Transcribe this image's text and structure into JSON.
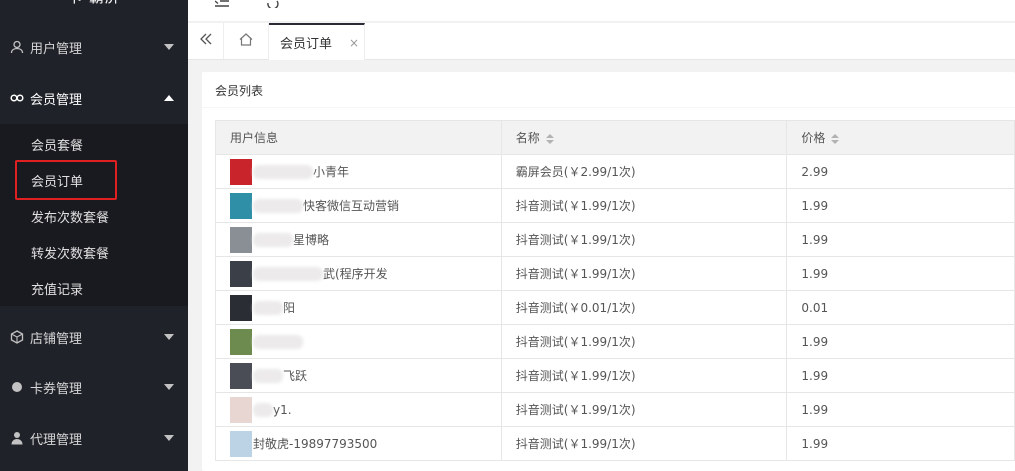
{
  "sidebar": {
    "logo": "卡 \t霸屏",
    "groups": [
      {
        "label": "用户管理",
        "icon": "user-icon"
      },
      {
        "label": "会员管理",
        "icon": "link-icon"
      },
      {
        "label": "店铺管理",
        "icon": "box-icon"
      },
      {
        "label": "卡券管理",
        "icon": "circle-icon"
      },
      {
        "label": "代理管理",
        "icon": "person-icon"
      }
    ],
    "member_items": [
      "会员套餐",
      "会员订单",
      "发布次数套餐",
      "转发次数套餐",
      "充值记录"
    ]
  },
  "header": {
    "menu_icon": "menu-fold-icon",
    "refresh_icon": "refresh-icon"
  },
  "tabs": {
    "active_label": "会员订单",
    "close_glyph": "×"
  },
  "card": {
    "title": "会员列表"
  },
  "table": {
    "headers": [
      "用户信息",
      "名称",
      "价格"
    ],
    "rows": [
      {
        "user": "小青年",
        "name": "霸屏会员(￥2.99/1次)",
        "price": "2.99",
        "avatar_color": "#c9242c"
      },
      {
        "user": "快客微信互动营销",
        "name": "抖音测试(￥1.99/1次)",
        "price": "1.99",
        "avatar_color": "#2f8fa6"
      },
      {
        "user": "星博略",
        "name": "抖音测试(￥1.99/1次)",
        "price": "1.99",
        "avatar_color": "#8a8f96"
      },
      {
        "user": "武(程序开发",
        "name": "抖音测试(￥1.99/1次)",
        "price": "1.99",
        "avatar_color": "#3b3f47"
      },
      {
        "user": "阳",
        "name": "抖音测试(￥0.01/1次)",
        "price": "0.01",
        "avatar_color": "#2a2d33"
      },
      {
        "user": "",
        "name": "抖音测试(￥1.99/1次)",
        "price": "1.99",
        "avatar_color": "#6e8b4f"
      },
      {
        "user": "飞跃",
        "name": "抖音测试(￥1.99/1次)",
        "price": "1.99",
        "avatar_color": "#4a4d55"
      },
      {
        "user": "y1.",
        "name": "抖音测试(￥1.99/1次)",
        "price": "1.99",
        "avatar_color": "#e8d6d2"
      },
      {
        "user": "封敬虎-19897793500",
        "name": "抖音测试(￥1.99/1次)",
        "price": "1.99",
        "avatar_color": "#bcd3e6"
      }
    ]
  }
}
